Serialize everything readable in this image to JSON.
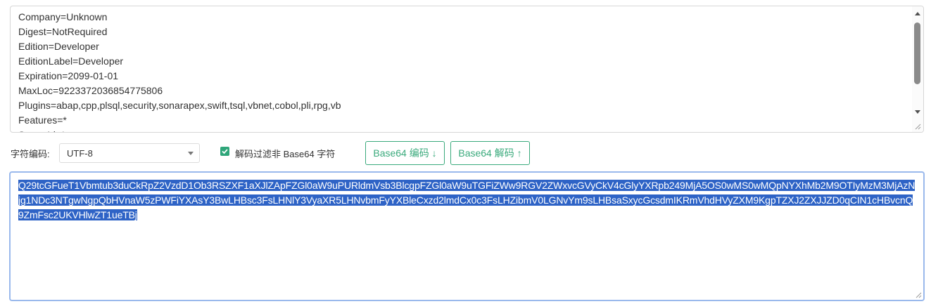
{
  "plain_text": {
    "lines": [
      "Company=Unknown",
      "Digest=NotRequired",
      "Edition=Developer",
      "EditionLabel=Developer",
      "Expiration=2099-01-01",
      "MaxLoc=9223372036854775806",
      "Plugins=abap,cpp,plsql,security,sonarapex,swift,tsql,vbnet,cobol,pli,rpg,vb",
      "Features=*",
      "ServerId=*"
    ]
  },
  "toolbar": {
    "charset_label": "字符编码:",
    "charset_value": "UTF-8",
    "filter_label": "解码过滤非 Base64 字符",
    "filter_checked": true,
    "encode_button": "Base64 编码 ↓",
    "decode_button": "Base64 解码 ↑"
  },
  "base64_text": {
    "value": "Q29tcGFueT1Vbmtub3duCkRpZ2VzdD1Ob3RSZXF1aXJlZApFZGl0aW9uPURldmVsb3BlcgpFZGl0aW9uTGFiZWw9RGV2ZWxvcGVyCkV4cGlyYXRpb249MjA5OS0wMS0wMQpNYXhMb2M9OTIyMzM3MjAzNjg1NDc3NTgwNgpQbHVnaW5zPWFiYXAsY3BwLHBsc3FsLHNlY3VyaXR5LHNvbmFyYXBleCxzd2lmdCx0c3FsLHZibmV0LGNvYm9sLHBsaSxycGcsdmIKRmVhdHVyZXM9KgpTZXJ2ZXJJZD0qCIN1cHBvcnQ9ZmFsc2UKVHlwZT1ueTBj"
  },
  "colors": {
    "accent_green": "#3aaa7c",
    "selection_blue": "#2e63c6",
    "focus_border": "#9ab9ec"
  }
}
